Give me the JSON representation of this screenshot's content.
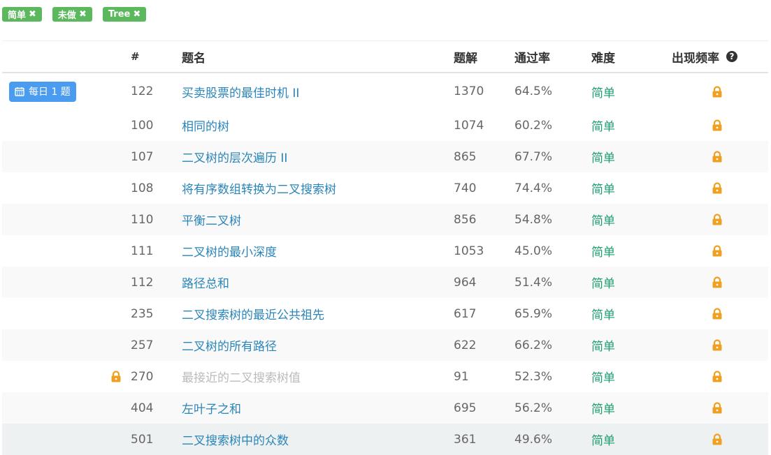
{
  "filters": [
    {
      "label": "简单",
      "remove": "✖"
    },
    {
      "label": "未做",
      "remove": "✖"
    },
    {
      "label": "Tree",
      "remove": "✖"
    }
  ],
  "table": {
    "headers": {
      "num": "#",
      "title": "题名",
      "solutions": "题解",
      "acceptance": "通过率",
      "difficulty": "难度",
      "frequency": "出现频率"
    },
    "daily_label": "每日 1 题",
    "rows": [
      {
        "num": "122",
        "title": "买卖股票的最佳时机 II",
        "solutions": "1370",
        "acceptance": "64.5%",
        "difficulty": "简单"
      },
      {
        "num": "100",
        "title": "相同的树",
        "solutions": "1074",
        "acceptance": "60.2%",
        "difficulty": "简单"
      },
      {
        "num": "107",
        "title": "二叉树的层次遍历 II",
        "solutions": "865",
        "acceptance": "67.7%",
        "difficulty": "简单"
      },
      {
        "num": "108",
        "title": "将有序数组转换为二叉搜索树",
        "solutions": "740",
        "acceptance": "74.4%",
        "difficulty": "简单"
      },
      {
        "num": "110",
        "title": "平衡二叉树",
        "solutions": "856",
        "acceptance": "54.8%",
        "difficulty": "简单"
      },
      {
        "num": "111",
        "title": "二叉树的最小深度",
        "solutions": "1053",
        "acceptance": "45.0%",
        "difficulty": "简单"
      },
      {
        "num": "112",
        "title": "路径总和",
        "solutions": "964",
        "acceptance": "51.4%",
        "difficulty": "简单"
      },
      {
        "num": "235",
        "title": "二叉搜索树的最近公共祖先",
        "solutions": "617",
        "acceptance": "65.9%",
        "difficulty": "简单"
      },
      {
        "num": "257",
        "title": "二叉树的所有路径",
        "solutions": "622",
        "acceptance": "66.2%",
        "difficulty": "简单"
      },
      {
        "num": "270",
        "title": "最接近的二叉搜索树值",
        "solutions": "91",
        "acceptance": "52.3%",
        "difficulty": "简单"
      },
      {
        "num": "404",
        "title": "左叶子之和",
        "solutions": "695",
        "acceptance": "56.2%",
        "difficulty": "简单"
      },
      {
        "num": "501",
        "title": "二叉搜索树中的众数",
        "solutions": "361",
        "acceptance": "49.6%",
        "difficulty": "简单"
      }
    ]
  },
  "icons": {
    "calendar": "calendar-icon",
    "lock": "lock-icon",
    "help": "question-circle-icon",
    "remove": "times-icon"
  },
  "colors": {
    "tag": "#5cb85c",
    "link": "#2a85b9",
    "difficulty_easy": "#1e9e6f",
    "lock": "#f0a020",
    "daily_button": "#4a9cf0"
  }
}
